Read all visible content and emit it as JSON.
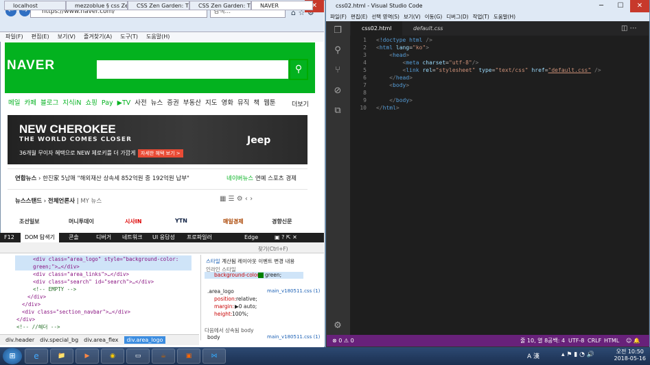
{
  "ie": {
    "url": "https://www.naver.com/",
    "search_placeholder": "검색...",
    "tabs": [
      "localhost",
      "mezzoblue § css Zen ...",
      "CSS Zen Garden: The...",
      "CSS Zen Garden: The...",
      "NAVER"
    ],
    "menu": [
      "파일(F)",
      "편집(E)",
      "보기(V)",
      "즐겨찾기(A)",
      "도구(T)",
      "도움말(H)"
    ]
  },
  "naver": {
    "logo": "NAVER",
    "nav": [
      "메일",
      "카페",
      "블로그",
      "지식iN",
      "쇼핑",
      "Pay",
      "▶TV",
      "사전",
      "뉴스",
      "증권",
      "부동산",
      "지도",
      "영화",
      "뮤직",
      "책",
      "웹툰"
    ],
    "more": "더보기",
    "ad_title": "NEW CHEROKEE",
    "ad_sub": "THE WORLD COMES CLOSER",
    "ad_text": "36개월 무이자 혜택으로 NEW 체로키를 더 가깝게",
    "ad_btn": "자세한 혜택 보기 >",
    "ad_brand": "Jeep",
    "news_source": "연합뉴스",
    "news_headline": "한진家 5남매 \"해외재산 상속세 852억원 중 192억원 납부\"",
    "news_links": [
      "네이버뉴스",
      "연예",
      "스포츠",
      "경제"
    ],
    "newsstand": "뉴스스탠드",
    "all_press": "전체언론사",
    "my_news": "MY 뉴스",
    "press": [
      "조선일보",
      "머니투데이",
      "시사IN",
      "YTN",
      "매일경제",
      "경향신문"
    ]
  },
  "devtools": {
    "f12": "F12",
    "tabs": [
      "DOM 탐색기",
      "콘솔",
      "디버거",
      "네트워크",
      "UI 응답성",
      "프로파일러"
    ],
    "edge": "Edge",
    "find": "찾기(Ctrl+F)",
    "lines": [
      "<div class=\"area_logo\" style=\"background-color:",
      "green;\">…</div>",
      "<div class=\"area_links\">…</div>",
      "<div class=\"search\" id=\"search\">…</div>",
      "<!-- EMPTY -->",
      "</div>",
      "</div>",
      "<div class=\"section_navbar\">…</div>",
      "</div>",
      "<!-- //해더 -->"
    ],
    "style_tabs": [
      "스타일",
      "계산됨",
      "레이아웃",
      "이벤트",
      "변경 내용"
    ],
    "inline_label": "인라인 스타일",
    "bg_prop": "background-color:",
    "bg_val": "green;",
    "rule": ".area_logo",
    "source": "main_v180511.css (1)",
    "props": [
      {
        "k": "position:",
        "v": "relative;"
      },
      {
        "k": "margin:",
        "v": "▶0 auto;"
      },
      {
        "k": "height:",
        "v": "100%;"
      }
    ],
    "inherited": "다음에서 상속됨 body",
    "body_rule": "body",
    "crumbs": [
      "div.header",
      "div.special_bg",
      "div.area_flex",
      "div.area_logo"
    ]
  },
  "vscode": {
    "title": "css02.html - Visual Studio Code",
    "menu": [
      "파일(F)",
      "편집(E)",
      "선택 영역(S)",
      "보기(V)",
      "이동(G)",
      "디버그(D)",
      "작업(T)",
      "도움말(H)"
    ],
    "tabs": [
      "css02.html",
      "default.css"
    ],
    "status": {
      "errors": "⊗ 0 ⚠ 0",
      "pos": "줄 10, 열 8",
      "spaces": "공백: 4",
      "enc": "UTF-8",
      "eol": "CRLF",
      "lang": "HTML"
    }
  },
  "taskbar": {
    "time": "오전 10:50",
    "date": "2018-05-16",
    "ime": "A 漢"
  }
}
